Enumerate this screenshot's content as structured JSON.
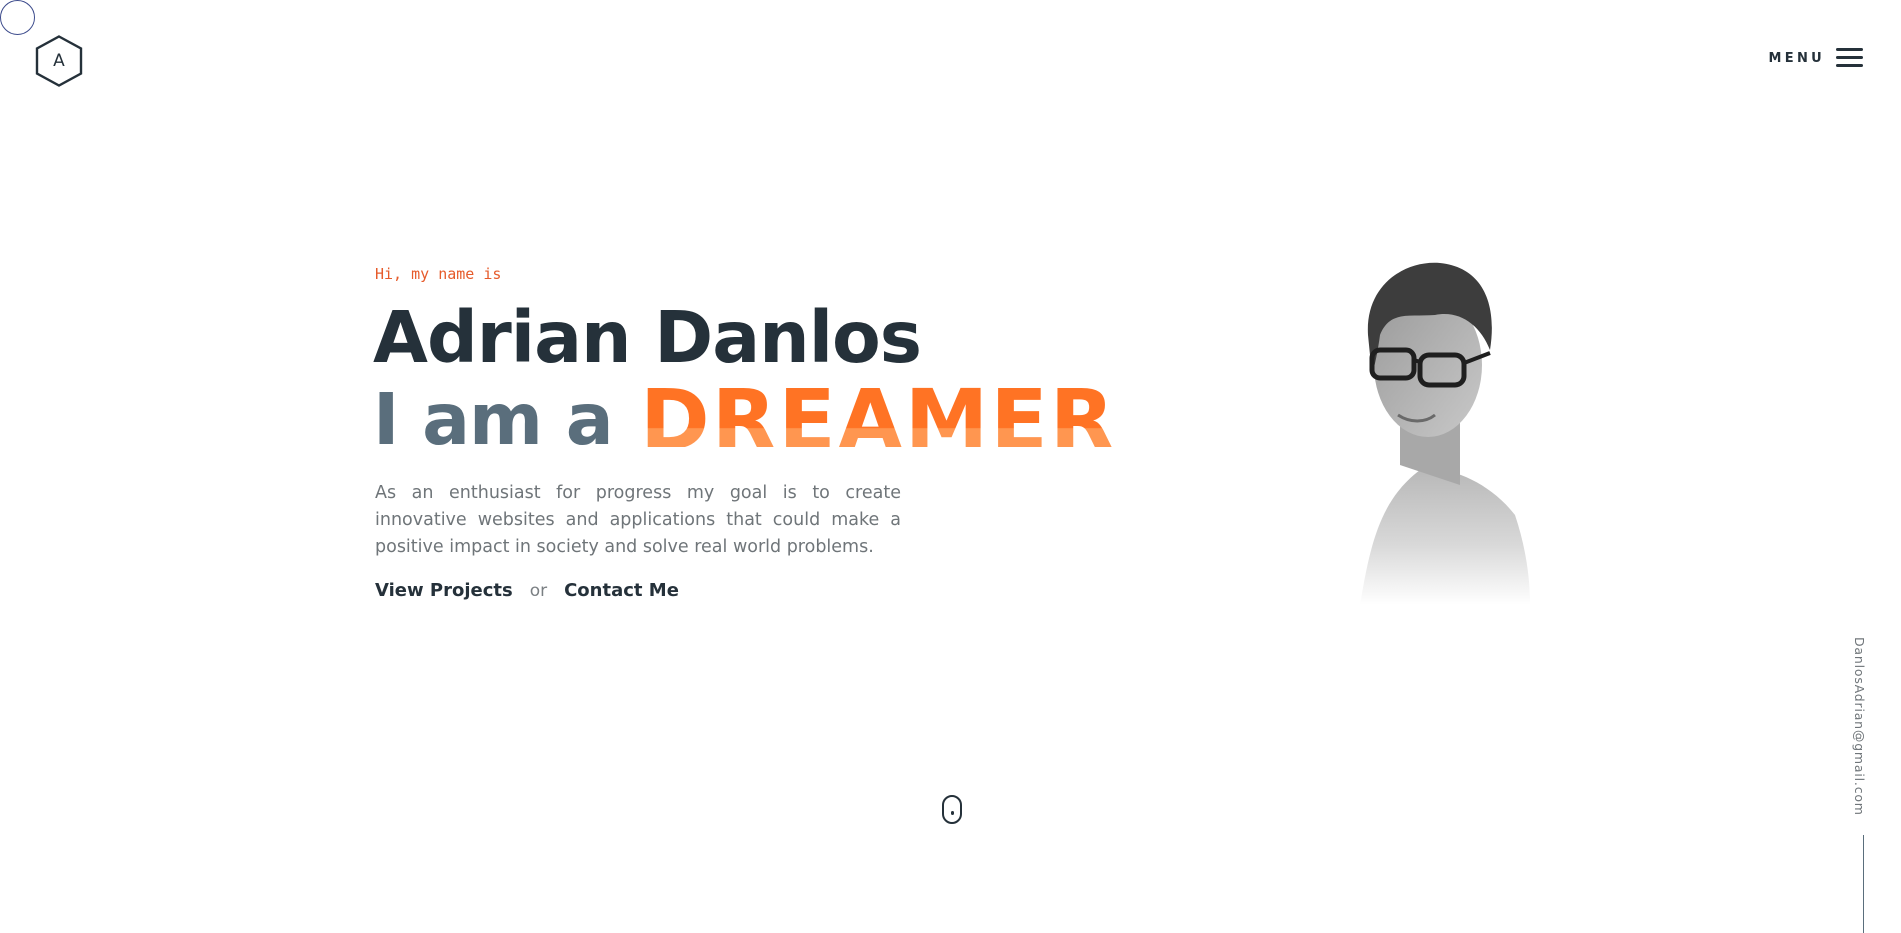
{
  "header": {
    "logo_letter": "A",
    "menu_label": "MENU"
  },
  "hero": {
    "greeting": "Hi, my name is",
    "name": "Adrian Danlos",
    "iam_prefix": "I am a",
    "role": "DREAMER",
    "description": "As an enthusiast for progress my goal is to create innovative websites and applications that could make a positive impact in society and solve real world problems.",
    "view_projects_label": "View Projects",
    "or_label": "or",
    "contact_label": "Contact Me"
  },
  "sidebar": {
    "email": "DanlosAdrian@gmail.com"
  },
  "colors": {
    "dark": "#25313a",
    "slate": "#5a6e7c",
    "accent": "#ff7324",
    "greeting": "#e65b2b"
  },
  "icons": {
    "logo": "hexagon-logo-icon",
    "menu": "hamburger-icon",
    "scroll": "scroll-mouse-icon"
  }
}
